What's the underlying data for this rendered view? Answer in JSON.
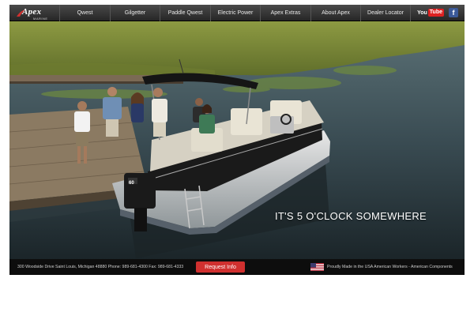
{
  "header": {
    "logo_text": "Apex",
    "logo_sub": "MARINE",
    "nav": [
      {
        "label": "Qwest",
        "name": "nav-qwest",
        "w": 64
      },
      {
        "label": "Gilgetter",
        "name": "nav-gilgetter",
        "w": 63
      },
      {
        "label": "Paddle Qwest",
        "name": "nav-paddle-qwest",
        "w": 64
      },
      {
        "label": "Electric Power",
        "name": "nav-electric-power",
        "w": 63
      },
      {
        "label": "Apex Extras",
        "name": "nav-apex-extras",
        "w": 64
      },
      {
        "label": "About Apex",
        "name": "nav-about-apex",
        "w": 63
      },
      {
        "label": "Dealer Locator",
        "name": "nav-dealer-locator",
        "w": 64
      }
    ],
    "youtube_you": "You",
    "youtube_tube": "Tube",
    "facebook": "f"
  },
  "hero": {
    "tagline": "IT'S 5 O'CLOCK SOMEWHERE",
    "motor_badge": "60"
  },
  "footer": {
    "address": "300 Woodside Drive    Saint Louis, Michigan 48880    Phone: 989-681-4300    Fax: 989-681-4333",
    "request_button": "Request Info",
    "made_in": "Proudly Made in the USA   American Workers - American Components"
  },
  "colors": {
    "accent": "#d0302f",
    "nav_bg": "#333333",
    "water": "#3b4f57",
    "grass": "#7a8a3a"
  }
}
